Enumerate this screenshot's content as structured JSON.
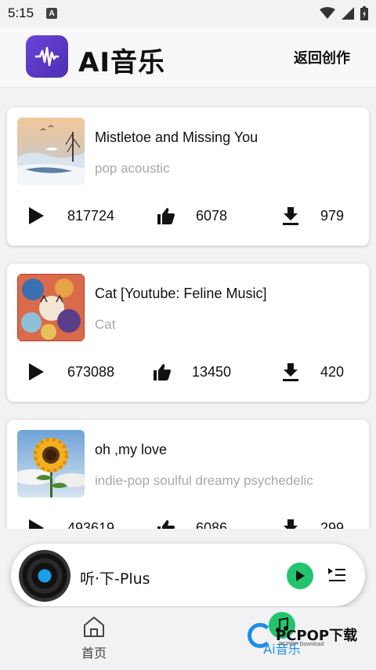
{
  "status": {
    "time": "5:15",
    "notif_icon": "A"
  },
  "header": {
    "title": "AI音乐",
    "back_label": "返回创作"
  },
  "songs": [
    {
      "title": "Mistletoe and Missing You",
      "tags": "pop acoustic",
      "plays": "817724",
      "likes": "6078",
      "downloads": "979"
    },
    {
      "title": "Cat [Youtube: Feline Music]",
      "tags": "Cat",
      "plays": "673088",
      "likes": "13450",
      "downloads": "420"
    },
    {
      "title": "oh ,my love",
      "tags": " indie-pop soulful  dreamy psychedelic",
      "plays": "493619",
      "likes": "6086",
      "downloads": "299"
    }
  ],
  "player": {
    "title": "听·下-Plus"
  },
  "tabs": [
    {
      "label": "首页"
    },
    {
      "label": "Ai音乐"
    }
  ],
  "watermark": {
    "brand": "PCPOP下载",
    "sub": "PCPOP Download"
  },
  "colors": {
    "accent_green": "#22c46d",
    "logo_purple": "#5b3bc9"
  }
}
